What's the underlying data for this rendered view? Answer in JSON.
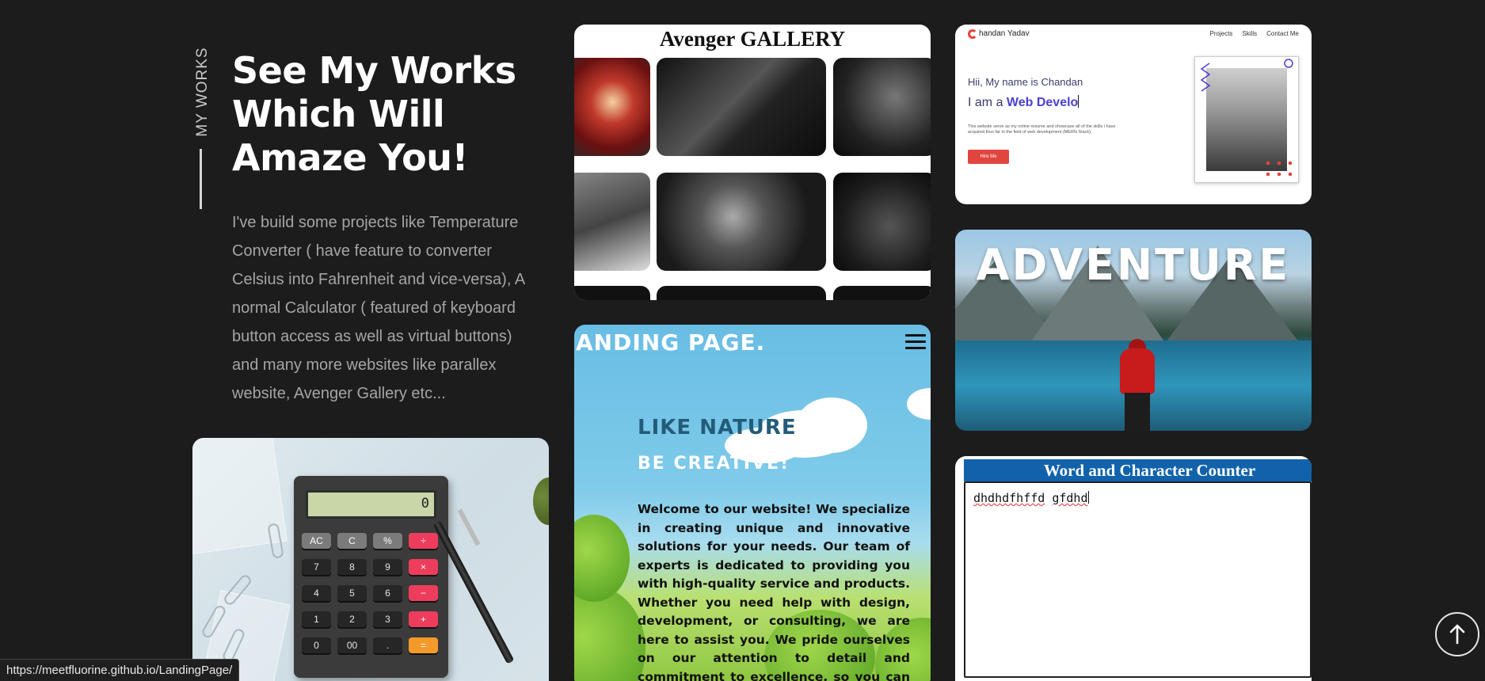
{
  "intro": {
    "side_label": "MY WORKS",
    "heading_lines": [
      "See My Works",
      "Which Will",
      "Amaze You!"
    ],
    "description": "I've build some projects like Temperature Converter ( have feature to converter Celsius into Fahrenheit and vice-versa), A normal Calculator ( featured of keyboard button access as well as virtual buttons) and many more websites like parallex website, Avenger Gallery etc..."
  },
  "calculator": {
    "display": "0",
    "keys": [
      "AC",
      "C",
      "%",
      "÷",
      "7",
      "8",
      "9",
      "×",
      "4",
      "5",
      "6",
      "−",
      "1",
      "2",
      "3",
      "+",
      "0",
      "00",
      ".",
      "="
    ]
  },
  "avenger": {
    "title": "Avenger GALLERY"
  },
  "portfolio": {
    "name": "handan Yadav",
    "nav": [
      "Projects",
      "Skills",
      "Contact Me"
    ],
    "greeting": "Hii, My name is Chandan",
    "role_prefix": "I am a ",
    "role_typed": "Web Develo",
    "blurb": "This website serve as my online resume and showcase all of the skills i have acquired thus far in the field of web development (MERN Stack).",
    "button": "Hire Me"
  },
  "landing": {
    "title": "ANDING PAGE.",
    "headline": "LIKE NATURE",
    "subheadline": "BE CREATIVE!",
    "body": "Welcome to our website! We specialize in creating unique and innovative solutions for your needs. Our team of experts is dedicated to providing you with high-quality service and products. Whether you need help with design, development, or consulting, we are here to assist you. We pride ourselves on our attention to detail and commitment to excellence, so you can trust that we will deliver results"
  },
  "adventure": {
    "title": "ADVENTURE"
  },
  "counter": {
    "title": "Word and Character Counter",
    "word1": "dhdhdfhffd",
    "word2": "gfdhd"
  },
  "status_bar": {
    "url": "https://meetfluorine.github.io/LandingPage/"
  },
  "colors": {
    "background": "#1c1c1c",
    "accent_red": "#e0463e",
    "counter_header": "#1162ab",
    "role_purple": "#4b3fd0"
  },
  "icons": {
    "scroll_top": "arrow-up-icon",
    "menu": "hamburger-menu-icon"
  }
}
